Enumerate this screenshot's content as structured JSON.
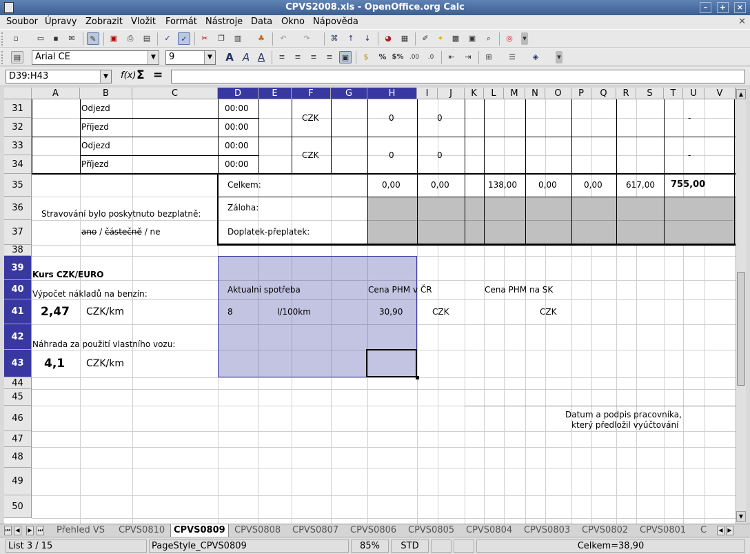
{
  "window": {
    "title": "CPVS2008.xls - OpenOffice.org Calc"
  },
  "menu": {
    "items": [
      "Soubor",
      "Úpravy",
      "Zobrazit",
      "Vložit",
      "Formát",
      "Nástroje",
      "Data",
      "Okno",
      "Nápověda"
    ]
  },
  "format": {
    "font": "Arial CE",
    "size": "9"
  },
  "formula_bar": {
    "name_box": "D39:H43",
    "fx": "f(x)",
    "sum": "Σ",
    "equals": "=",
    "content": ""
  },
  "columns": [
    "A",
    "B",
    "C",
    "D",
    "E",
    "F",
    "G",
    "H",
    "I",
    "J",
    "K",
    "L",
    "M",
    "N",
    "O",
    "P",
    "Q",
    "R",
    "S",
    "T",
    "U",
    "V"
  ],
  "selected_columns": [
    "D",
    "E",
    "F",
    "G",
    "H"
  ],
  "rows": [
    "31",
    "32",
    "33",
    "34",
    "35",
    "36",
    "37",
    "38",
    "39",
    "40",
    "41",
    "42",
    "43",
    "44",
    "45",
    "46",
    "47",
    "48",
    "49",
    "50"
  ],
  "selected_rows": [
    "39",
    "40",
    "41",
    "42",
    "43"
  ],
  "cells": {
    "b31": "Odjezd",
    "b32": "Příjezd",
    "b33": "Odjezd",
    "b34": "Příjezd",
    "d31": "00:00",
    "d32": "00:00",
    "d33": "00:00",
    "d34": "00:00",
    "f31": "CZK",
    "f33": "CZK",
    "h31": "0",
    "h33": "0",
    "i31": "0",
    "i33": "0",
    "t31": "-",
    "t33": "-",
    "d35": "Celkem:",
    "h35": "0,00",
    "i35": "0,00",
    "l35": "138,00",
    "n35": "0,00",
    "p35": "0,00",
    "r35": "617,00",
    "t35": "755,00",
    "d36": "Záloha:",
    "d37": "Doplatek-přeplatek:",
    "a36": "Stravování bylo poskytnuto bezplatně:",
    "a37_ano": "ano",
    "a37_sep1": " / ",
    "a37_castecne": "částečně",
    "a37_rest": " / ne",
    "a39": "Kurs CZK/EURO",
    "a40": "Výpočet nákladů na benzín:",
    "d40": "Aktualni spotřeba",
    "h40": "Cena PHM v ČR",
    "l40": "Cena PHM na SK",
    "a41": "2,47",
    "b41": "CZK/km",
    "d41": "8",
    "f41": "l/100km",
    "h41": "30,90",
    "i41": "CZK",
    "n41": "CZK",
    "a42": "Náhrada za použití vlastního vozu:",
    "a43": "4,1",
    "b43": "CZK/km",
    "signature_line1": "Datum a podpis pracovníka,",
    "signature_line2": "který předložil vyúčtování"
  },
  "sheet_tabs": [
    "Přehled VS",
    "CPVS0810",
    "CPVS0809",
    "CPVS0808",
    "CPVS0807",
    "CPVS0806",
    "CPVS0805",
    "CPVS0804",
    "CPVS0803",
    "CPVS0802",
    "CPVS0801",
    "C"
  ],
  "active_tab": "CPVS0809",
  "status": {
    "sheet": "List 3 / 15",
    "page_style": "PageStyle_CPVS0809",
    "zoom": "85%",
    "mode": "STD",
    "sum": "Celkem=38,90"
  },
  "colors": {
    "title_bar": "#3c5f91",
    "selection": "#3838a0",
    "shaded_cells": "#c0c0c0"
  }
}
